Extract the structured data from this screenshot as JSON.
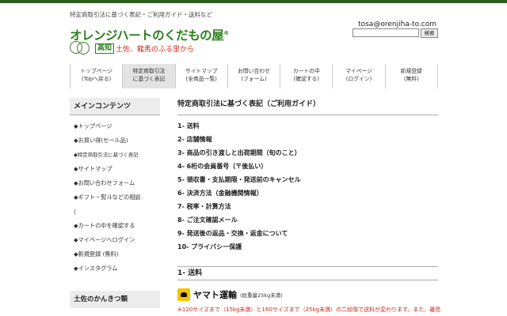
{
  "header": {
    "tagline": "特定商取引法に基づく表記・ご利用ガイド・送料など",
    "logo_main": "オレンジハートのくだもの屋",
    "logo_reg": "®",
    "logo_kochi": "高知",
    "logo_sub": "土佐、龍馬のふる里から",
    "email": "tosa@orenjiha-to.com",
    "search_placeholder": "",
    "search_button": "検索"
  },
  "nav": {
    "items": [
      {
        "label": "トップページ\n(Topへ戻る)"
      },
      {
        "label": "特定商取引法\nに基づく表記"
      },
      {
        "label": "サイトマップ\n(全商品一覧)"
      },
      {
        "label": "お問い合わせ\n(フォーム)"
      },
      {
        "label": "カートの中\n(確認する)"
      },
      {
        "label": "マイページ\n(ログイン)"
      },
      {
        "label": "新規登録\n(無料)"
      }
    ]
  },
  "sidebar": {
    "heading": "メインコンテンツ",
    "items": [
      {
        "label": "◆トップページ"
      },
      {
        "label": "◆お買い得(セール品)"
      },
      {
        "label": "◆特定商取引法に基づく表記"
      },
      {
        "label": "◆サイトマップ"
      },
      {
        "label": "◆お問い合わせフォーム"
      },
      {
        "label": "◆ギフト・熨斗などの相談"
      },
      {
        "label": "|"
      },
      {
        "label": "◆カートの中を確認する"
      },
      {
        "label": "◆マイページへログイン"
      },
      {
        "label": "◆新規登録 (無料)"
      },
      {
        "label": "◆インスタグラム"
      }
    ],
    "heading2": "土佐のかんきつ類"
  },
  "main": {
    "title": "特定商取引法に基づく表記（ご利用ガイド）",
    "toc": [
      {
        "label": "1- 送料"
      },
      {
        "label": "2- 店舗情報"
      },
      {
        "label": "3- 商品の引き渡しと出荷期間（旬のこと）"
      },
      {
        "label": "4- 6桁の会員番号（〒後払い）"
      },
      {
        "label": "5- 領収書・支払期限・発送前のキャンセル"
      },
      {
        "label": "6- 決済方法（金融機関情報）"
      },
      {
        "label": "7- 税率・計算方法"
      },
      {
        "label": "8- ご注文確認メール"
      },
      {
        "label": "9- 発送後の返品・交換・返金について"
      },
      {
        "label": "10- プライバシー保護"
      }
    ],
    "section1_title": "1- 送料",
    "yamato_name": "ヤマト運輸",
    "yamato_note": "(総重量25kg未満)",
    "notice": "※120サイズまで（15kg未満）と160サイズまで（25kg未満）の二段階で送料が変わります。また、離島"
  },
  "colors": {
    "brand_green": "#2e7d1e",
    "accent_red": "#d02a1e",
    "yamato_yellow": "#f6c400"
  }
}
